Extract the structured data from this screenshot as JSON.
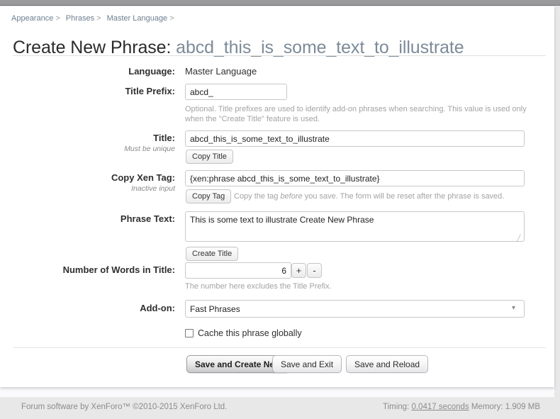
{
  "breadcrumb": [
    {
      "label": "Appearance",
      "sep": ">"
    },
    {
      "label": "Phrases",
      "sep": ">"
    },
    {
      "label": "Master Language",
      "sep": ">"
    }
  ],
  "header": {
    "title_prefix": "Create New Phrase: ",
    "title_value": "abcd_this_is_some_text_to_illustrate"
  },
  "form": {
    "language": {
      "label": "Language:",
      "value": "Master Language"
    },
    "title_prefix": {
      "label": "Title Prefix:",
      "value": "abcd_",
      "hint": "Optional. Title prefixes are used to identify add-on phrases when searching. This value is used only when the \"Create Title\" feature is used."
    },
    "title": {
      "label": "Title:",
      "sublabel": "Must be unique",
      "value": "abcd_this_is_some_text_to_illustrate",
      "button": "Copy Title"
    },
    "xen_tag": {
      "label": "Copy Xen Tag:",
      "sublabel": "Inactive input",
      "value": "{xen:phrase abcd_this_is_some_text_to_illustrate}",
      "button": "Copy Tag",
      "hint_pre": "Copy the tag ",
      "hint_em": "before",
      "hint_post": " you save. The form will be reset after the phrase is saved."
    },
    "phrase_text": {
      "label": "Phrase Text:",
      "value": "This is some text to illustrate Create New Phrase",
      "button": "Create Title"
    },
    "word_count": {
      "label": "Number of Words in Title:",
      "value": "6",
      "plus": "+",
      "minus": "-",
      "hint": "The number here excludes the Title Prefix."
    },
    "addon": {
      "label": "Add-on:",
      "selected": "Fast Phrases",
      "options": [
        "Fast Phrases"
      ],
      "arrow": "chevron-down-icon"
    },
    "cache_globally": {
      "label": "Cache this phrase globally",
      "checked": false
    }
  },
  "actions": {
    "primary": "Save and Create New",
    "exit": "Save and Exit",
    "reload": "Save and Reload"
  },
  "footer": {
    "copyright": "Forum software by XenForo™ ©2010-2015 XenForo Ltd.",
    "timing_label": "Timing: ",
    "timing_value": "0.0417 seconds",
    "memory": " Memory: 1.909 MB"
  }
}
